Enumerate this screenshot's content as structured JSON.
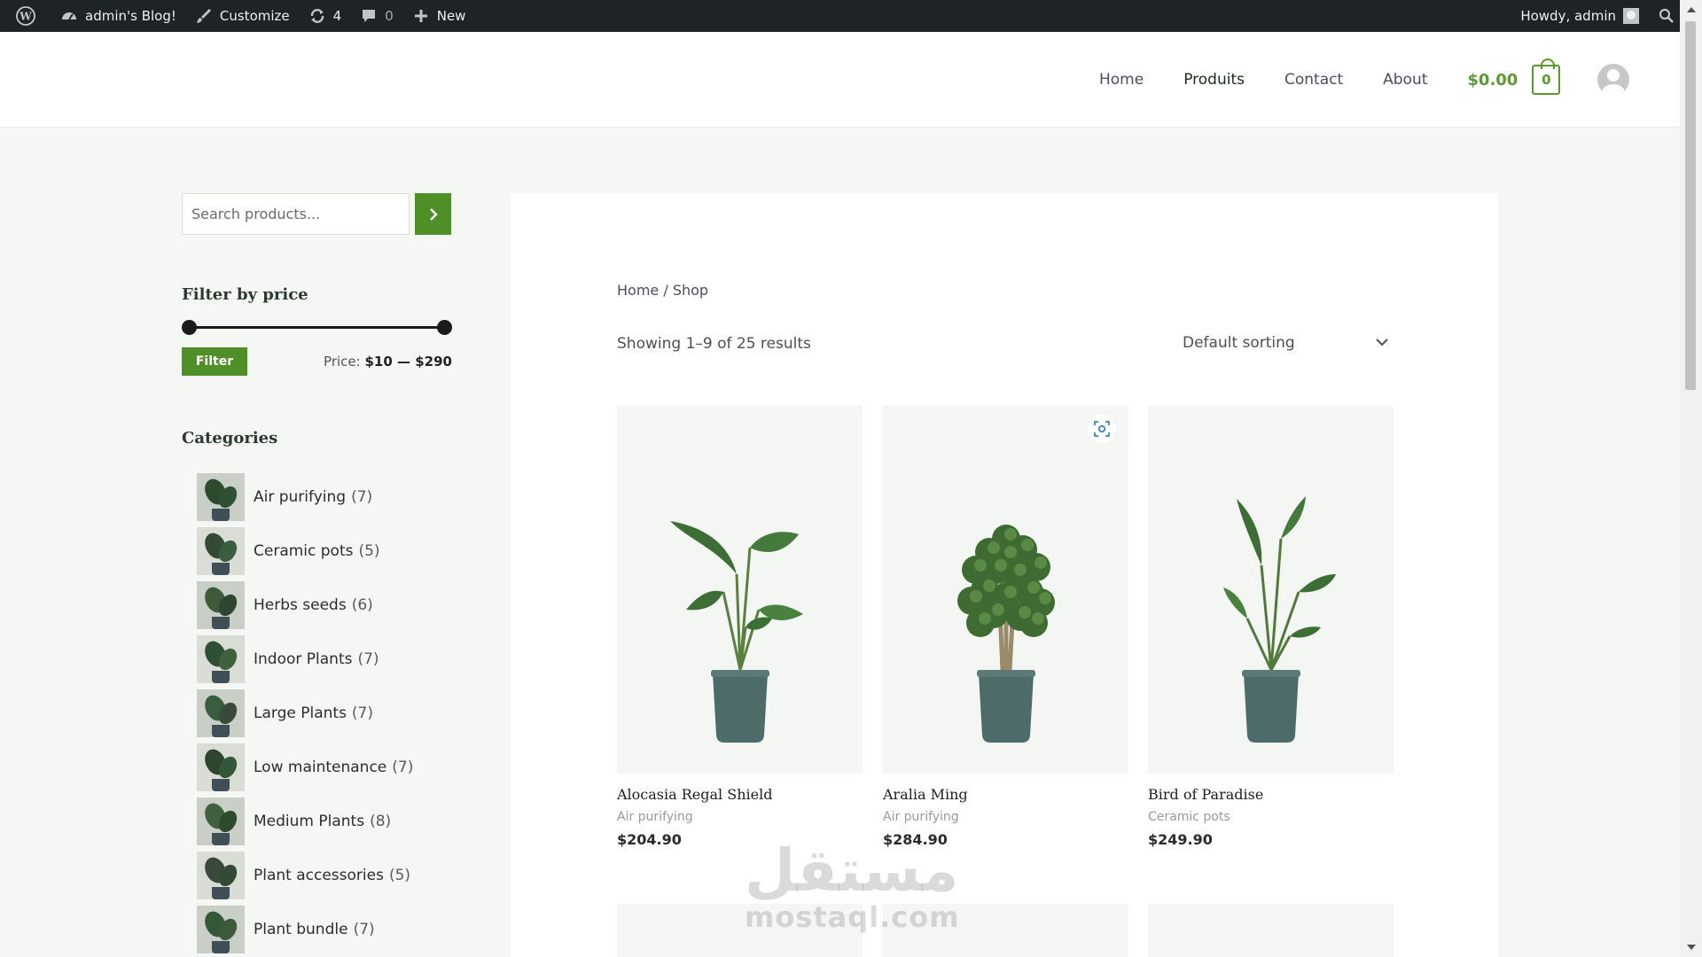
{
  "admin_bar": {
    "site_name": "admin's Blog!",
    "customize": "Customize",
    "updates_count": "4",
    "comments_count": "0",
    "new_label": "New",
    "howdy": "Howdy, admin"
  },
  "header": {
    "nav": [
      "Home",
      "Produits",
      "Contact",
      "About"
    ],
    "cart_total": "$0.00",
    "cart_count": "0"
  },
  "sidebar": {
    "search_placeholder": "Search products...",
    "filter_title": "Filter by price",
    "filter_button": "Filter",
    "price_prefix": "Price:",
    "price_range": "$10 — $290",
    "price_min_fraction": 0,
    "price_max_fraction": 1,
    "categories_title": "Categories",
    "categories": [
      {
        "name": "Air purifying",
        "count": "(7)"
      },
      {
        "name": "Ceramic pots",
        "count": "(5)"
      },
      {
        "name": "Herbs seeds",
        "count": "(6)"
      },
      {
        "name": "Indoor Plants",
        "count": "(7)"
      },
      {
        "name": "Large Plants",
        "count": "(7)"
      },
      {
        "name": "Low maintenance",
        "count": "(7)"
      },
      {
        "name": "Medium Plants",
        "count": "(8)"
      },
      {
        "name": "Plant accessories",
        "count": "(5)"
      },
      {
        "name": "Plant bundle",
        "count": "(7)"
      }
    ]
  },
  "shop": {
    "breadcrumb_home": "Home",
    "breadcrumb_separator": " / ",
    "breadcrumb_current": "Shop",
    "result_count": "Showing 1–9 of 25 results",
    "sorting": "Default sorting",
    "products": [
      {
        "title": "Alocasia Regal Shield",
        "category": "Air purifying",
        "price": "$204.90"
      },
      {
        "title": "Aralia Ming",
        "category": "Air purifying",
        "price": "$284.90"
      },
      {
        "title": "Bird of Paradise",
        "category": "Ceramic pots",
        "price": "$249.90"
      }
    ]
  },
  "watermark": {
    "arabic": "مستقل",
    "latin": "mostaql.com"
  },
  "colors": {
    "accent": "#4f8f28",
    "admin_bar": "#1d2327",
    "pot": "#4d6b68",
    "leaf": "#3c6e35"
  }
}
